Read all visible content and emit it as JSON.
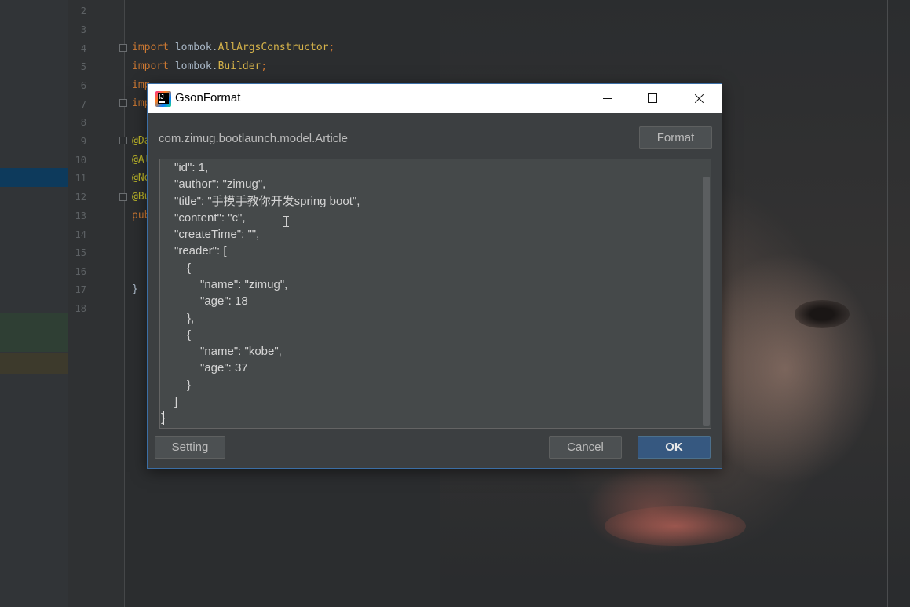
{
  "ide": {
    "line_numbers": [
      "2",
      "3",
      "4",
      "5",
      "6",
      "7",
      "8",
      "9",
      "10",
      "11",
      "12",
      "13",
      "14",
      "15",
      "16",
      "17",
      "18"
    ],
    "imports": [
      {
        "kw": "import",
        "text": " lombok.",
        "cls": "AllArgsConstructor",
        "semi": ";"
      },
      {
        "kw": "import",
        "text": " lombok.",
        "cls": "Builder",
        "semi": ";"
      },
      {
        "kw": "imp",
        "text": "",
        "cls": "",
        "semi": ""
      },
      {
        "kw": "imp",
        "text": "",
        "cls": "",
        "semi": ""
      }
    ],
    "annotations": [
      "@Da",
      "@Al",
      "@No",
      "@Bu"
    ],
    "class_decl": "pub",
    "closing_brace": "}"
  },
  "dialog": {
    "title": "GsonFormat",
    "app_icon_text": "IJ",
    "class_name": "com.zimug.bootlaunch.model.Article",
    "format_label": "Format",
    "setting_label": "Setting",
    "cancel_label": "Cancel",
    "ok_label": "OK",
    "json_lines": [
      "\"id\": 1,",
      "\"author\": \"zimug\",",
      "\"title\": \"手摸手教你开发spring boot\",",
      "\"content\": \"c\",",
      "\"createTime\": \"\",",
      "\"reader\": [",
      "{",
      "\"name\": \"zimug\",",
      "\"age\": 18",
      "},",
      "{",
      "\"name\": \"kobe\",",
      "\"age\": 37",
      "}",
      "]",
      "}"
    ]
  },
  "colors": {
    "annotation_arrow": "#e8353a",
    "ok_button": "#365880",
    "dialog_bg": "#3c3f41"
  }
}
